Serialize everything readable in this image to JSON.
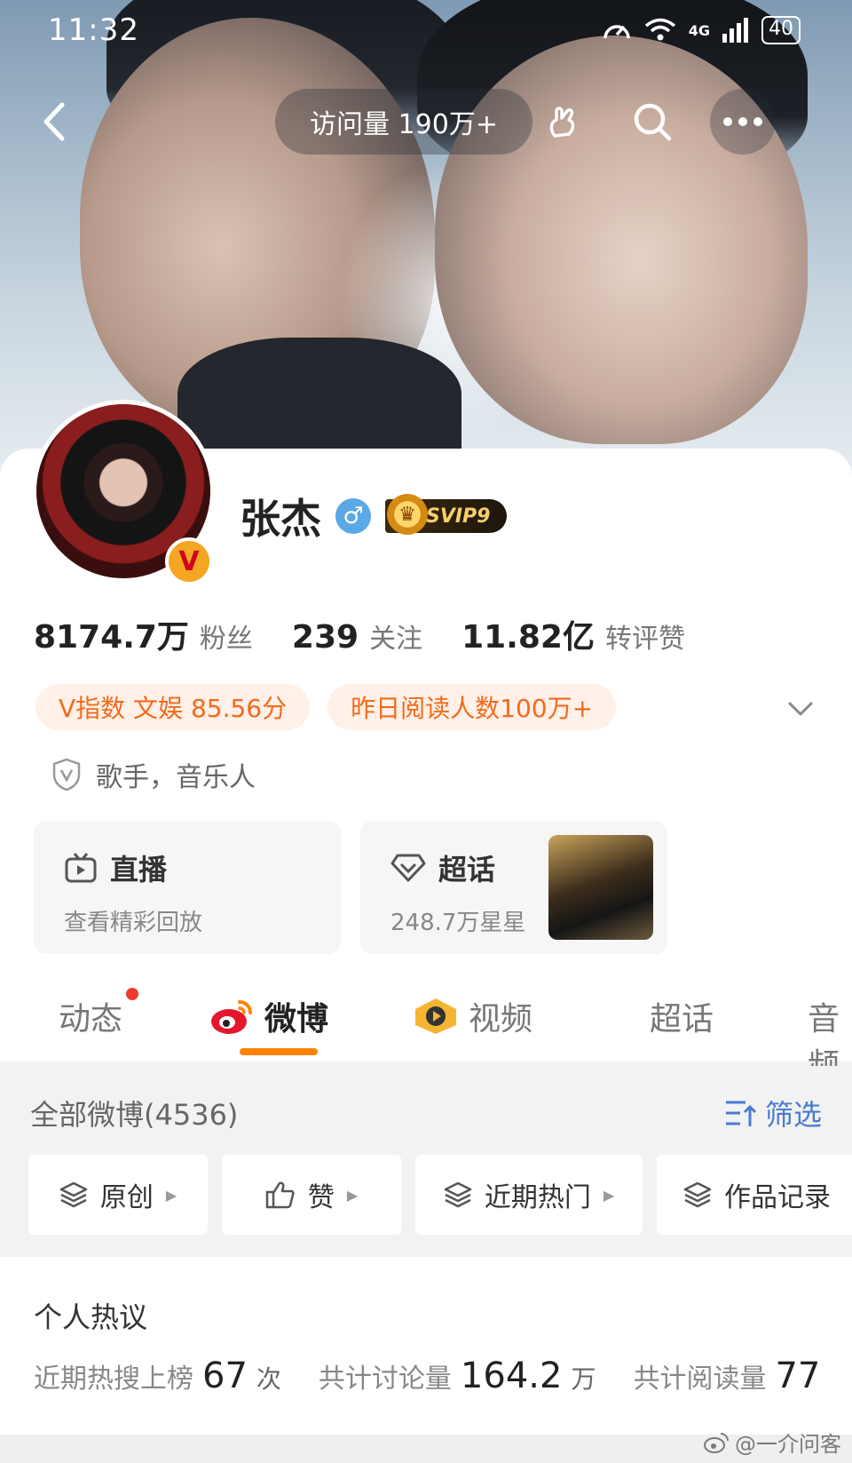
{
  "status_bar": {
    "time": "11:32",
    "network": "4G",
    "battery": "40"
  },
  "topbar": {
    "visit_count": "访问量 190万+"
  },
  "profile": {
    "name": "张杰",
    "gender_symbol": "♂",
    "vip_badge": "SVIP9",
    "verified_badge": "V",
    "stats": [
      {
        "value": "8174.7万",
        "label": "粉丝"
      },
      {
        "value": "239",
        "label": "关注"
      },
      {
        "value": "11.82亿",
        "label": "转评赞"
      }
    ],
    "tags": [
      "V指数 文娱 85.56分",
      "昨日阅读人数100万+"
    ],
    "bio": "歌手，音乐人"
  },
  "entry_cards": {
    "live": {
      "title": "直播",
      "subtitle": "查看精彩回放"
    },
    "super_topic": {
      "title": "超话",
      "subtitle": "248.7万星星"
    }
  },
  "tabs": [
    {
      "label": "动态",
      "active": false,
      "has_dot": true
    },
    {
      "label": "微博",
      "active": true
    },
    {
      "label": "视频",
      "active": false
    },
    {
      "label": "超话",
      "active": false
    },
    {
      "label": "音频",
      "active": false
    }
  ],
  "feed": {
    "all_label": "全部微博(4536)",
    "filter_label": "筛选",
    "chips": [
      "原创",
      "赞",
      "近期热门",
      "作品记录"
    ]
  },
  "hot_topics": {
    "title": "个人热议",
    "items": [
      {
        "key": "近期热搜上榜",
        "value": "67",
        "unit": "次"
      },
      {
        "key": "共计讨论量",
        "value": "164.2",
        "unit": "万"
      },
      {
        "key": "共计阅读量",
        "value": "77",
        "unit": ""
      }
    ]
  },
  "watermark": "@一介问客",
  "colors": {
    "accent": "#ff8200",
    "tag_text": "#f26a1b",
    "link_blue": "#4a7ccf"
  }
}
